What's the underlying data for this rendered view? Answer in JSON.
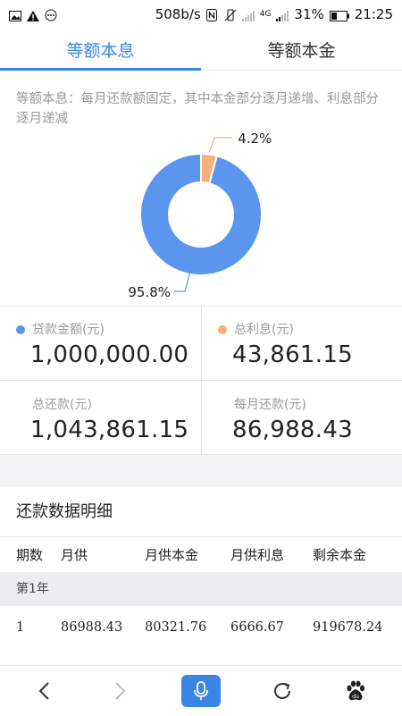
{
  "status_bar": {
    "speed": "508b/s",
    "network": "4G",
    "battery": "31%",
    "time": "21:25"
  },
  "tabs": [
    {
      "label": "等额本息",
      "active": true
    },
    {
      "label": "等额本金",
      "active": false
    }
  ],
  "description": "等额本息：每月还款额固定，其中本金部分逐月递增、利息部分逐月递减",
  "chart_data": {
    "type": "pie",
    "categories": [
      "贷款金额(元)",
      "总利息(元)"
    ],
    "values": [
      95.8,
      4.2
    ],
    "labels": [
      "95.8%",
      "4.2%"
    ],
    "colors": [
      "#5b95ee",
      "#f2b27e"
    ]
  },
  "summary": {
    "loan_label": "贷款金额(元)",
    "loan_value": "1,000,000.00",
    "interest_label": "总利息(元)",
    "interest_value": "43,861.15",
    "total_label": "总还款(元)",
    "total_value": "1,043,861.15",
    "monthly_label": "每月还款(元)",
    "monthly_value": "86,988.43",
    "loan_color": "#5b95ee",
    "interest_color": "#f2b27e"
  },
  "details": {
    "title": "还款数据明细",
    "headers": [
      "期数",
      "月供",
      "月供本金",
      "月供利息",
      "剩余本金"
    ],
    "year_label": "第1年",
    "rows": [
      [
        "1",
        "86988.43",
        "80321.76",
        "6666.67",
        "919678.24"
      ]
    ]
  },
  "nav": {
    "icons": [
      "back-icon",
      "forward-icon",
      "mic-icon",
      "refresh-icon",
      "paw-icon"
    ],
    "accent": "#3b86e5"
  }
}
